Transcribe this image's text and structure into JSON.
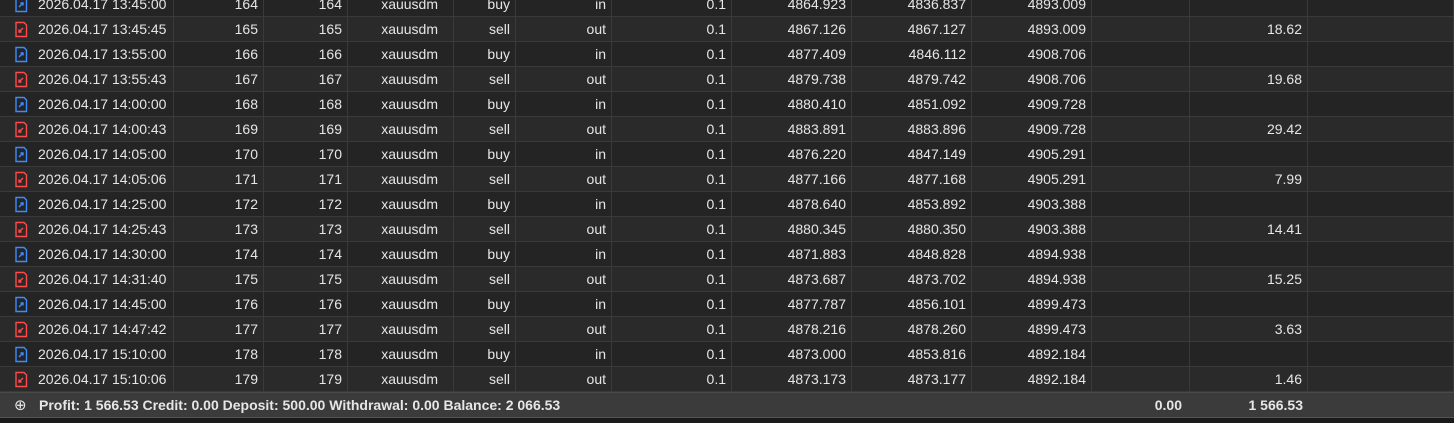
{
  "colors": {
    "buy_icon": "#3d8cff",
    "sell_icon": "#ff4a4a"
  },
  "rows": [
    {
      "time": "2026.04.17 13:45:00",
      "order": "164",
      "deal": "164",
      "symbol": "xauusdm",
      "type": "buy",
      "direction": "in",
      "volume": "0.1",
      "price": "4864.923",
      "sl": "4836.837",
      "tp": "4893.009",
      "commission": "",
      "profit": ""
    },
    {
      "time": "2026.04.17 13:45:45",
      "order": "165",
      "deal": "165",
      "symbol": "xauusdm",
      "type": "sell",
      "direction": "out",
      "volume": "0.1",
      "price": "4867.126",
      "sl": "4867.127",
      "tp": "4893.009",
      "commission": "",
      "profit": "18.62"
    },
    {
      "time": "2026.04.17 13:55:00",
      "order": "166",
      "deal": "166",
      "symbol": "xauusdm",
      "type": "buy",
      "direction": "in",
      "volume": "0.1",
      "price": "4877.409",
      "sl": "4846.112",
      "tp": "4908.706",
      "commission": "",
      "profit": ""
    },
    {
      "time": "2026.04.17 13:55:43",
      "order": "167",
      "deal": "167",
      "symbol": "xauusdm",
      "type": "sell",
      "direction": "out",
      "volume": "0.1",
      "price": "4879.738",
      "sl": "4879.742",
      "tp": "4908.706",
      "commission": "",
      "profit": "19.68"
    },
    {
      "time": "2026.04.17 14:00:00",
      "order": "168",
      "deal": "168",
      "symbol": "xauusdm",
      "type": "buy",
      "direction": "in",
      "volume": "0.1",
      "price": "4880.410",
      "sl": "4851.092",
      "tp": "4909.728",
      "commission": "",
      "profit": ""
    },
    {
      "time": "2026.04.17 14:00:43",
      "order": "169",
      "deal": "169",
      "symbol": "xauusdm",
      "type": "sell",
      "direction": "out",
      "volume": "0.1",
      "price": "4883.891",
      "sl": "4883.896",
      "tp": "4909.728",
      "commission": "",
      "profit": "29.42"
    },
    {
      "time": "2026.04.17 14:05:00",
      "order": "170",
      "deal": "170",
      "symbol": "xauusdm",
      "type": "buy",
      "direction": "in",
      "volume": "0.1",
      "price": "4876.220",
      "sl": "4847.149",
      "tp": "4905.291",
      "commission": "",
      "profit": ""
    },
    {
      "time": "2026.04.17 14:05:06",
      "order": "171",
      "deal": "171",
      "symbol": "xauusdm",
      "type": "sell",
      "direction": "out",
      "volume": "0.1",
      "price": "4877.166",
      "sl": "4877.168",
      "tp": "4905.291",
      "commission": "",
      "profit": "7.99"
    },
    {
      "time": "2026.04.17 14:25:00",
      "order": "172",
      "deal": "172",
      "symbol": "xauusdm",
      "type": "buy",
      "direction": "in",
      "volume": "0.1",
      "price": "4878.640",
      "sl": "4853.892",
      "tp": "4903.388",
      "commission": "",
      "profit": ""
    },
    {
      "time": "2026.04.17 14:25:43",
      "order": "173",
      "deal": "173",
      "symbol": "xauusdm",
      "type": "sell",
      "direction": "out",
      "volume": "0.1",
      "price": "4880.345",
      "sl": "4880.350",
      "tp": "4903.388",
      "commission": "",
      "profit": "14.41"
    },
    {
      "time": "2026.04.17 14:30:00",
      "order": "174",
      "deal": "174",
      "symbol": "xauusdm",
      "type": "buy",
      "direction": "in",
      "volume": "0.1",
      "price": "4871.883",
      "sl": "4848.828",
      "tp": "4894.938",
      "commission": "",
      "profit": ""
    },
    {
      "time": "2026.04.17 14:31:40",
      "order": "175",
      "deal": "175",
      "symbol": "xauusdm",
      "type": "sell",
      "direction": "out",
      "volume": "0.1",
      "price": "4873.687",
      "sl": "4873.702",
      "tp": "4894.938",
      "commission": "",
      "profit": "15.25"
    },
    {
      "time": "2026.04.17 14:45:00",
      "order": "176",
      "deal": "176",
      "symbol": "xauusdm",
      "type": "buy",
      "direction": "in",
      "volume": "0.1",
      "price": "4877.787",
      "sl": "4856.101",
      "tp": "4899.473",
      "commission": "",
      "profit": ""
    },
    {
      "time": "2026.04.17 14:47:42",
      "order": "177",
      "deal": "177",
      "symbol": "xauusdm",
      "type": "sell",
      "direction": "out",
      "volume": "0.1",
      "price": "4878.216",
      "sl": "4878.260",
      "tp": "4899.473",
      "commission": "",
      "profit": "3.63"
    },
    {
      "time": "2026.04.17 15:10:00",
      "order": "178",
      "deal": "178",
      "symbol": "xauusdm",
      "type": "buy",
      "direction": "in",
      "volume": "0.1",
      "price": "4873.000",
      "sl": "4853.816",
      "tp": "4892.184",
      "commission": "",
      "profit": ""
    },
    {
      "time": "2026.04.17 15:10:06",
      "order": "179",
      "deal": "179",
      "symbol": "xauusdm",
      "type": "sell",
      "direction": "out",
      "volume": "0.1",
      "price": "4873.173",
      "sl": "4873.177",
      "tp": "4892.184",
      "commission": "",
      "profit": "1.46"
    }
  ],
  "summary": {
    "expand_icon": "plus-circle-icon",
    "text": "Profit: 1 566.53  Credit: 0.00  Deposit: 500.00  Withdrawal: 0.00  Balance: 2 066.53",
    "total_commission": "0.00",
    "total_profit": "1 566.53"
  }
}
